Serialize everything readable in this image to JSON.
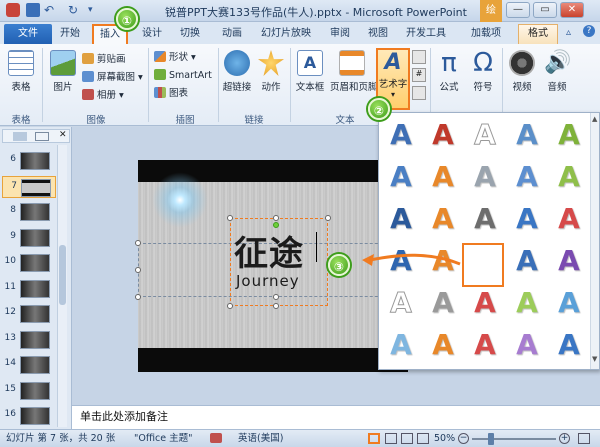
{
  "window": {
    "title": "锐普PPT大赛133号作品(牛人).pptx - Microsoft PowerPoint",
    "context_tab": "绘",
    "controls": {
      "minimize": "—",
      "restore": "▭",
      "close": "✕"
    }
  },
  "tabs": [
    "文件",
    "开始",
    "插入",
    "设计",
    "切换",
    "动画",
    "幻灯片放映",
    "审阅",
    "视图",
    "开发工具",
    "加载项",
    "格式"
  ],
  "ribbon": {
    "groups": {
      "table": {
        "label": "表格",
        "buttons": {
          "table": "表格"
        }
      },
      "image": {
        "label": "图像",
        "buttons": {
          "picture": "图片",
          "clipart": "剪贴画",
          "screenshot": "屏幕截图",
          "album": "相册"
        }
      },
      "illustration": {
        "label": "插图",
        "buttons": {
          "shapes": "形状",
          "smartart": "SmartArt",
          "chart": "图表"
        }
      },
      "links": {
        "label": "链接",
        "buttons": {
          "hyperlink": "超链接",
          "action": "动作"
        }
      },
      "text": {
        "label": "文本",
        "buttons": {
          "textbox": "文本框",
          "header_footer": "页眉和页脚",
          "wordart": "艺术字"
        }
      },
      "symbols": {
        "buttons": {
          "equation": "公式",
          "symbol": "符号"
        }
      },
      "media": {
        "buttons": {
          "video": "视频",
          "audio": "音频"
        }
      }
    }
  },
  "slide_pane": {
    "slides": [
      "6",
      "7",
      "8",
      "9",
      "10",
      "11",
      "12",
      "13",
      "14",
      "15",
      "16"
    ],
    "selected": "7"
  },
  "slide": {
    "title_text": "征途",
    "subtitle_text": "Journey"
  },
  "notes_placeholder": "单击此处添加备注",
  "statusbar": {
    "slide_info": "幻灯片 第 7 张，共 20 张",
    "theme": "\"Office 主题\"",
    "language": "英语(美国)",
    "zoom": "50%"
  },
  "callouts": [
    "①",
    "②",
    "③"
  ],
  "colors": {
    "accent_orange": "#f07b20",
    "callout_green": "#3d9d1b",
    "file_tab_blue": "#2160b3"
  },
  "wordart_gallery": [
    [
      "#3f6fb5",
      "#c0392b",
      "#d6d6d6",
      "#5b8fc9",
      "#7fb23a"
    ],
    [
      "#4a7fc4",
      "#e8882a",
      "#9aa4ae",
      "#5d8fd0",
      "#8fbf4a"
    ],
    [
      "#2c5a9b",
      "#e8882a",
      "#6d6d6d",
      "#3a76c4",
      "#d64a4a"
    ],
    [
      "#2f66b0",
      "#e8882a",
      "#111111",
      "#3a6fb8",
      "#7a4bb0"
    ],
    [
      "#cfcfcf",
      "#9a9a9a",
      "#d64a4a",
      "#9ccc5a",
      "#5aa0d8"
    ],
    [
      "#7fb6e0",
      "#e8882a",
      "#d64a4a",
      "#a77cd0",
      "#3a76c4"
    ]
  ]
}
